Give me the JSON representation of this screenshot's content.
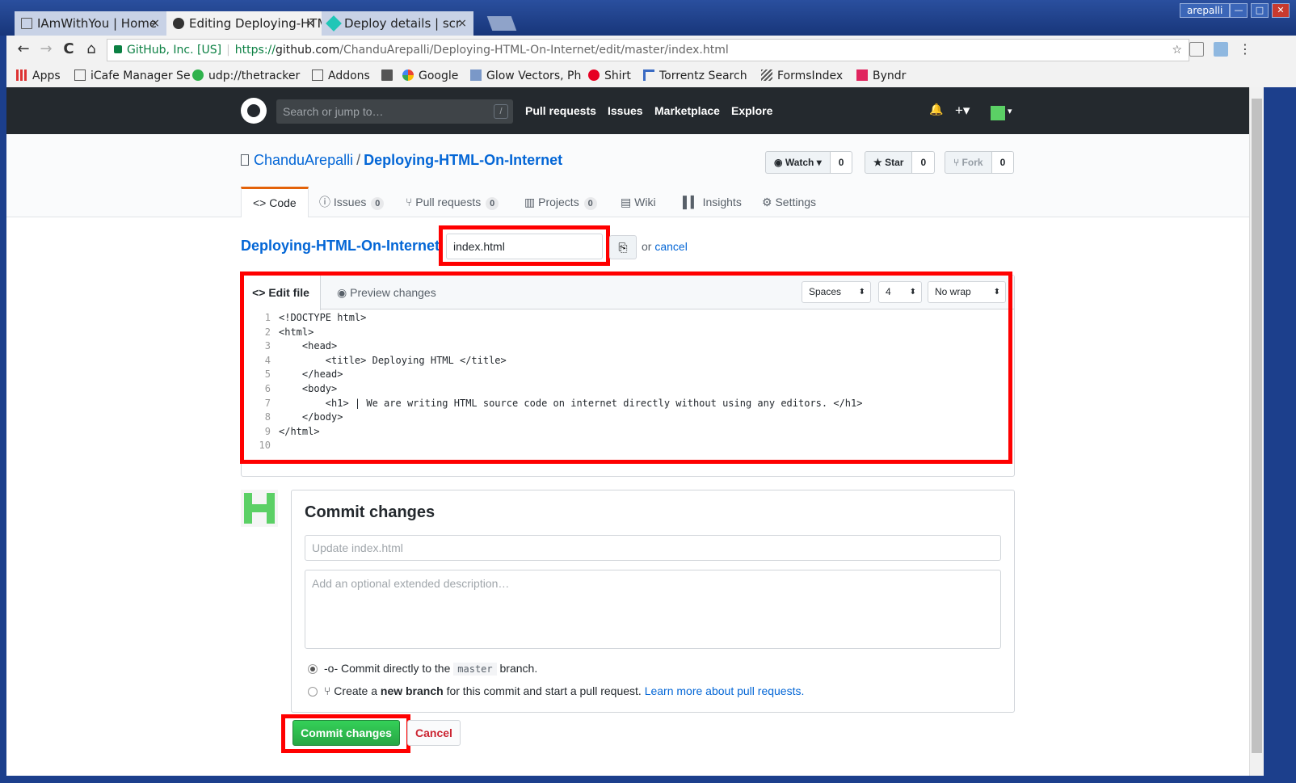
{
  "browser": {
    "tabs": [
      {
        "title": "IAmWithYou | Home",
        "active": false
      },
      {
        "title": "Editing Deploying-HTML",
        "active": true
      },
      {
        "title": "Deploy details | scr",
        "active": false
      }
    ],
    "tab_close": "×",
    "user": "arepalli",
    "window_buttons": [
      "—",
      "□",
      "✕"
    ],
    "nav": {
      "back": "←",
      "forward": "→",
      "reload": "C",
      "home": "⌂"
    },
    "address": {
      "site_identity": "GitHub, Inc. [US]",
      "scheme": "https://",
      "host": "github.com",
      "path": "/ChanduArepalli/Deploying-HTML-On-Internet/edit/master/index.html",
      "star": "☆"
    },
    "bookmarks": [
      {
        "label": "Apps",
        "icon": "apps-grid-icon"
      },
      {
        "label": "iCafe Manager Se",
        "icon": "page-icon"
      },
      {
        "label": "udp://thetracker",
        "icon": "star-green-icon"
      },
      {
        "label": "Addons",
        "icon": "page-icon"
      },
      {
        "label": "",
        "icon": "folder-icon"
      },
      {
        "label": "Google",
        "icon": "google-icon"
      },
      {
        "label": "Glow Vectors, Ph",
        "icon": "image-icon"
      },
      {
        "label": "Shirt",
        "icon": "pinterest-icon"
      },
      {
        "label": "Torrentz Search",
        "icon": "torrentz-icon"
      },
      {
        "label": "FormsIndex",
        "icon": "formsindex-icon"
      },
      {
        "label": "Byndr",
        "icon": "byndr-icon"
      }
    ]
  },
  "github": {
    "search_placeholder": "Search or jump to…",
    "search_key": "/",
    "nav": [
      "Pull requests",
      "Issues",
      "Marketplace",
      "Explore"
    ],
    "header_icons": {
      "bell": "🔔",
      "plus": "+▾",
      "avatar_caret": "▾"
    },
    "repo": {
      "owner": "ChanduArepalli",
      "separator": "/",
      "name": "Deploying-HTML-On-Internet",
      "watch": {
        "label": "Watch ▾",
        "count": "0"
      },
      "star": {
        "label": "Star",
        "count": "0"
      },
      "fork": {
        "label": "Fork",
        "count": "0"
      }
    },
    "tabs": [
      {
        "label": "Code",
        "count": null,
        "icon": "code-icon"
      },
      {
        "label": "Issues",
        "count": "0",
        "icon": "issue-icon"
      },
      {
        "label": "Pull requests",
        "count": "0",
        "icon": "pr-icon"
      },
      {
        "label": "Projects",
        "count": "0",
        "icon": "project-icon"
      },
      {
        "label": "Wiki",
        "count": null,
        "icon": "wiki-icon"
      },
      {
        "label": "Insights",
        "count": null,
        "icon": "graph-icon"
      },
      {
        "label": "Settings",
        "count": null,
        "icon": "gear-icon"
      }
    ],
    "editor": {
      "repo_link": "Deploying-HTML-On-Internet",
      "filename": "index.html",
      "or_text": "or",
      "cancel_link": "cancel",
      "tab_edit": "Edit file",
      "tab_preview": "Preview changes",
      "indent_mode": "Spaces",
      "indent_size": "4",
      "wrap_mode": "No wrap",
      "lines": [
        {
          "n": "1",
          "text": "<!DOCTYPE html>"
        },
        {
          "n": "2",
          "text": "<html>"
        },
        {
          "n": "3",
          "text": "    <head>"
        },
        {
          "n": "4",
          "text": "        <title> Deploying HTML </title>"
        },
        {
          "n": "5",
          "text": "    </head>"
        },
        {
          "n": "6",
          "text": "    <body>"
        },
        {
          "n": "7",
          "text": "        <h1> | We are writing HTML source code on internet directly without using any editors. </h1>"
        },
        {
          "n": "8",
          "text": "    </body>"
        },
        {
          "n": "9",
          "text": "</html>"
        },
        {
          "n": "10",
          "text": ""
        }
      ]
    },
    "commit": {
      "title": "Commit changes",
      "summary_placeholder": "Update index.html",
      "description_placeholder": "Add an optional extended description…",
      "option_direct_pre": "Commit directly to the",
      "option_direct_branch": "master",
      "option_direct_post": "branch.",
      "option_new_pre": "Create a",
      "option_new_bold": "new branch",
      "option_new_post": "for this commit and start a pull request.",
      "option_new_link": "Learn more about pull requests.",
      "submit_label": "Commit changes",
      "cancel_label": "Cancel"
    }
  },
  "colors": {
    "highlight": "#ff0000",
    "link": "#0366d6",
    "commit_green": "#28a745"
  }
}
